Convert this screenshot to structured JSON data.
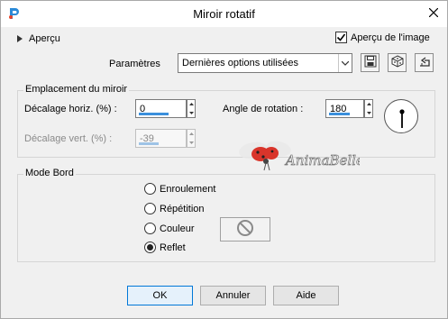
{
  "window": {
    "title": "Miroir rotatif",
    "app_icon": "paintshop-pro-icon",
    "close_icon": "close-icon"
  },
  "preview": {
    "toggle_label": "Aperçu",
    "image_preview_label": "Aperçu de l'image",
    "image_preview_checked": true
  },
  "presets": {
    "label": "Paramètres",
    "selected": "Dernières options utilisées",
    "tools": [
      "save-preset-icon",
      "randomize-icon",
      "reset-icon"
    ]
  },
  "mirror_group": {
    "legend": "Emplacement du miroir",
    "horizontal_offset": {
      "label": "Décalage horiz. (%) :",
      "value": "0"
    },
    "vertical_offset": {
      "label": "Décalage vert. (%) :",
      "value": "-39",
      "disabled": true
    },
    "rotation_angle": {
      "label": "Angle de rotation :",
      "value": "180"
    }
  },
  "watermark": {
    "text": "AnimaBelle",
    "image": "ladybug-logo"
  },
  "edge_group": {
    "legend": "Mode Bord",
    "options": [
      {
        "label": "Enroulement",
        "selected": false
      },
      {
        "label": "Répétition",
        "selected": false
      },
      {
        "label": "Couleur",
        "selected": false
      },
      {
        "label": "Reflet",
        "selected": true
      }
    ],
    "color_swatch_icon": "no-color-icon"
  },
  "buttons": {
    "ok": "OK",
    "cancel": "Annuler",
    "help": "Aide"
  }
}
